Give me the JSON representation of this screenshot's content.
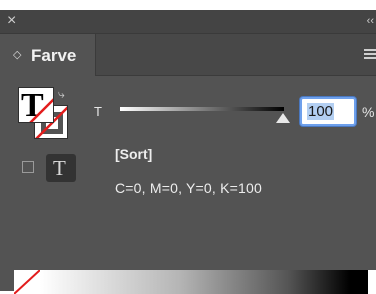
{
  "window": {
    "close_icon": "×",
    "collapse_icon": "‹‹"
  },
  "tab": {
    "arrows_icon": "◇",
    "label": "Farve"
  },
  "swatches": {
    "fill_glyph": "T",
    "text_mode_glyph": "T",
    "swap_icon": "⤷"
  },
  "tint": {
    "label": "T",
    "value": "100",
    "unit": "%",
    "level": 1.0
  },
  "swatch": {
    "name": "[Sort]",
    "values": "C=0, M=0, Y=0, K=100"
  },
  "colors": {
    "panel_bg": "#535353",
    "none_red": "#e21c1c",
    "focus_blue": "#6ea0ec"
  }
}
